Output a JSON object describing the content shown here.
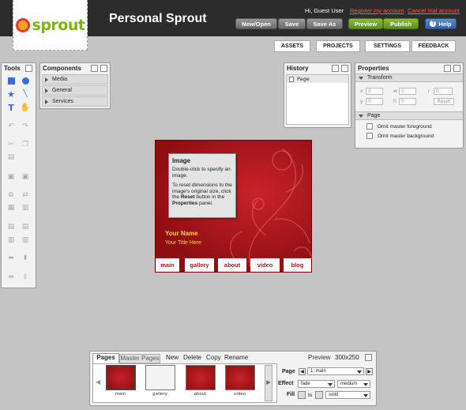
{
  "app": {
    "title": "Personal Sprout",
    "logo_text": "sprout"
  },
  "user": {
    "greeting": "Hi, Guest User",
    "register": "Register my account",
    "cancel": "Cancel trial account"
  },
  "toolbar": {
    "new_open": "New/Open",
    "save": "Save",
    "save_as": "Save As",
    "preview": "Preview",
    "publish": "Publish",
    "help": "Help"
  },
  "tabs": [
    "ASSETS",
    "PROJECTS",
    "SETTINGS",
    "FEEDBACK"
  ],
  "tools": {
    "title": "Tools"
  },
  "components": {
    "title": "Components",
    "items": [
      "Media",
      "General",
      "Services"
    ]
  },
  "history": {
    "title": "History",
    "items": [
      "Page"
    ]
  },
  "properties": {
    "title": "Properties",
    "transform": "Transform",
    "labels": [
      "x",
      "y",
      "w",
      "h",
      "r"
    ],
    "values": [
      "0",
      "0",
      "0",
      "0",
      "0"
    ],
    "reset": "Reset",
    "page_section": "Page",
    "omit_fg": "Omit master foreground",
    "omit_bg": "Omit master background"
  },
  "canvas": {
    "tooltip_title": "Image",
    "tooltip_line1": "Double-click to specify an image.",
    "tooltip_line2_a": "To reset dimensions to the image's original size, click the ",
    "tooltip_reset": "Reset",
    "tooltip_line2_b": " button in the ",
    "tooltip_props": "Properties",
    "tooltip_line2_c": " panel.",
    "name": "Your Name",
    "jobtitle": "Your Title Here",
    "nav": [
      "main",
      "gallery",
      "about",
      "video",
      "blog"
    ]
  },
  "pages": {
    "tab_pages": "Pages",
    "tab_master": "Master Pages",
    "actions": [
      "New",
      "Delete",
      "Copy",
      "Rename"
    ],
    "preview_label": "Preview",
    "size": "300x250",
    "thumbs": [
      "main",
      "gallery",
      "about",
      "video"
    ],
    "page_label": "Page",
    "page_value": "1: main",
    "effect_label": "Effect",
    "effect_value": "fade",
    "speed_value": "medium",
    "fill_label": "Fill",
    "fill_to": "to",
    "fill_value": "solid"
  }
}
